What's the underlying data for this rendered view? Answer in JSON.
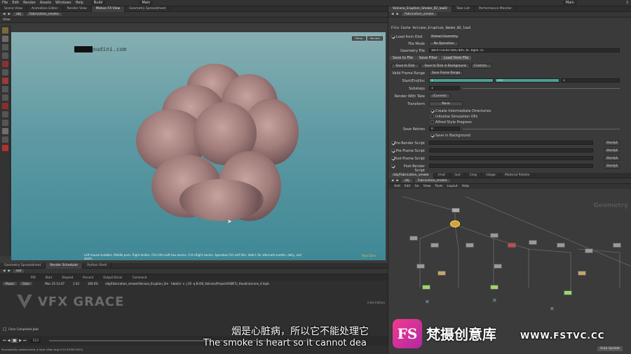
{
  "menubar": {
    "items": [
      "File",
      "Edit",
      "Render",
      "Assets",
      "Windows",
      "Help"
    ],
    "desktop_left": "Build",
    "desktop_right": "Main"
  },
  "left_tabs": [
    "Scene View",
    "Animation Editor",
    "Render View",
    "Motion FX View",
    "Geometry Spreadsheet"
  ],
  "left_path": {
    "root": "obj",
    "node": "Fabrication_smoke"
  },
  "viewport": {
    "label": "View",
    "persp_btn": "Persp",
    "cam_btn": "No cam",
    "watermark": "oudini.com",
    "status": "Left mouse tumbles. Middle pans. Right dollies. Ctrl+Alt+Left box-zooms. Ctrl+Right zooms. Spacebar-Ctrl-Left tilts. Hold L for alternate tumble, dolly, and zoom.",
    "corner_label": "Pyro Sims"
  },
  "bottom": {
    "tabs": [
      "Geometry Spreadsheet",
      "Render Scheduler",
      "Python Shell"
    ],
    "path": "out",
    "columns": [
      "PID",
      "Start",
      "Elapsed",
      "Percent",
      "Output Driver",
      "Command"
    ],
    "row": {
      "pid": "",
      "start": "Mon 21:13:47",
      "elapsed": "1:33",
      "percent": "100.0%",
      "driver": "/obj/Fabrication_smoke/Volcano_Eruption_Smoke_02",
      "command": "hbatch -v -j 20 -q B:/00_Volcano/Project/HSBF1/_Houdini/scene_4.hiplc"
    },
    "pause": "Pause",
    "clear": "Clear",
    "clear_completed": "Clear Completed Jobs",
    "logo": "VFX GRACE",
    "frame": "113",
    "status_msg": "Successfully saved scene_4.hiplc (Mon Aug 9 22:43:58 2021)",
    "indie": "Indie Edition",
    "auto_update": "Auto Update"
  },
  "right": {
    "tabs": [
      "Volcano_Eruption_Smoke_02_lowD",
      "Take List",
      "Performance Monitor"
    ],
    "path": "Fabrication_smoke",
    "node_title": "File Cache  Volcano_Eruption_Smoke_02_low1",
    "load_from_disk": "Load from Disk",
    "reload": "Reload Geometry",
    "file_mode_label": "File Mode",
    "file_mode_value": "No Operation",
    "geometry_file_label": "Geometry File",
    "geometry_file_value": "$HIP/cache/$OS/$OS.$F.bgeo.sc",
    "subtabs": [
      "Save to File",
      "Save Filter",
      "Load from File"
    ],
    "save_disk": "Save to Disk",
    "save_bg": "Save to Disk in Background",
    "controls": "Controls...",
    "valid_range_label": "Valid Frame Range",
    "valid_range_value": "Save Frame Range",
    "start_end_label": "Start/End/Inc",
    "start": "1",
    "end": "144",
    "inc": "1",
    "substeps_label": "Substeps",
    "substeps": "1",
    "render_take_label": "Render With Take",
    "render_take_value": "(Current)",
    "transform_label": "Transform",
    "transform_value": "None",
    "create_dirs": "Create Intermediate Directories",
    "init_sim": "Initialize Simulation OPs",
    "alfred": "Alfred Style Progress",
    "save_retries_label": "Save Retries",
    "save_retries": "0",
    "save_bg_cb": "Save in Background",
    "scripts": [
      {
        "label": "Pre-Render Script",
        "lang": "Hscript"
      },
      {
        "label": "Pre-Frame Script",
        "lang": "Hscript"
      },
      {
        "label": "Post-Frame Script",
        "lang": "Hscript"
      },
      {
        "label": "Post-Render Script",
        "lang": "Hscript"
      }
    ]
  },
  "network": {
    "tabs": [
      "/obj/Fabrication_smoke",
      "/mat",
      "/out",
      "/img",
      "/stage",
      "Material Palette"
    ],
    "path_root": "obj",
    "path_node": "Fabrication_smoke",
    "menu": [
      "Add",
      "Edit",
      "Go",
      "View",
      "Tools",
      "Layout",
      "Help"
    ],
    "context_label": "Geometry"
  },
  "subtitles": {
    "chinese": "烟是心脏病，所以它不能处理它",
    "english": "The smoke is heart so it cannot dea",
    "brand_cn": "梵摄创意库",
    "brand_url": "WWW.FSTVC.CC",
    "brand_logo": "FS"
  },
  "colors": {
    "viewport_top": "#86aeb1",
    "viewport_bottom": "#3f8895",
    "smoke": "#a07c7a",
    "slider_teal": "#4d9e95",
    "brand_pink": "#d3338f"
  }
}
